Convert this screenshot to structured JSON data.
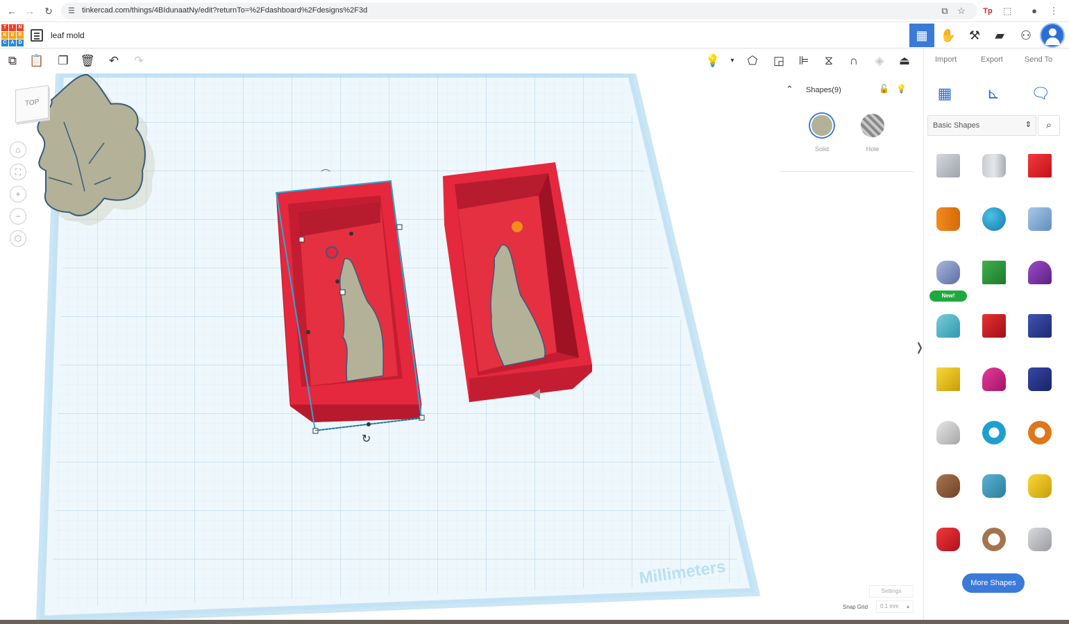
{
  "browser": {
    "url": "tinkercad.com/things/4BIdunaatNy/edit?returnTo=%2Fdashboard%2Fdesigns%2F3d",
    "back_icon": "arrow-left-icon",
    "forward_icon": "arrow-right-icon",
    "reload_icon": "reload-icon"
  },
  "app": {
    "logo_letters": [
      "T",
      "I",
      "N",
      "K",
      "E",
      "R",
      "C",
      "A",
      "D"
    ],
    "logo_colors": [
      "#e8412c",
      "#e8412c",
      "#e8412c",
      "#f7a21b",
      "#f7a21b",
      "#f7a21b",
      "#2a8ad4",
      "#2a8ad4",
      "#2a8ad4"
    ],
    "design_title": "leaf mold",
    "accent_color": "#3b7ad8"
  },
  "workplane": {
    "viewcube_label": "TOP",
    "watermark": "Millimeters",
    "settings_label": "Settings",
    "snap_grid_label": "Snap Grid",
    "snap_grid_value": "0.1 mm",
    "mold_color": "#e5283d",
    "leaf_color": "#b3b197"
  },
  "shapes_panel": {
    "title": "Shapes(9)",
    "solid_label": "Solid",
    "hole_label": "Hole",
    "solid_color": "#b3b197"
  },
  "right_panel": {
    "import_label": "Import",
    "export_label": "Export",
    "send_to_label": "Send To",
    "library_value": "Basic Shapes",
    "new_badge": "New!",
    "more_shapes_label": "More Shapes"
  }
}
